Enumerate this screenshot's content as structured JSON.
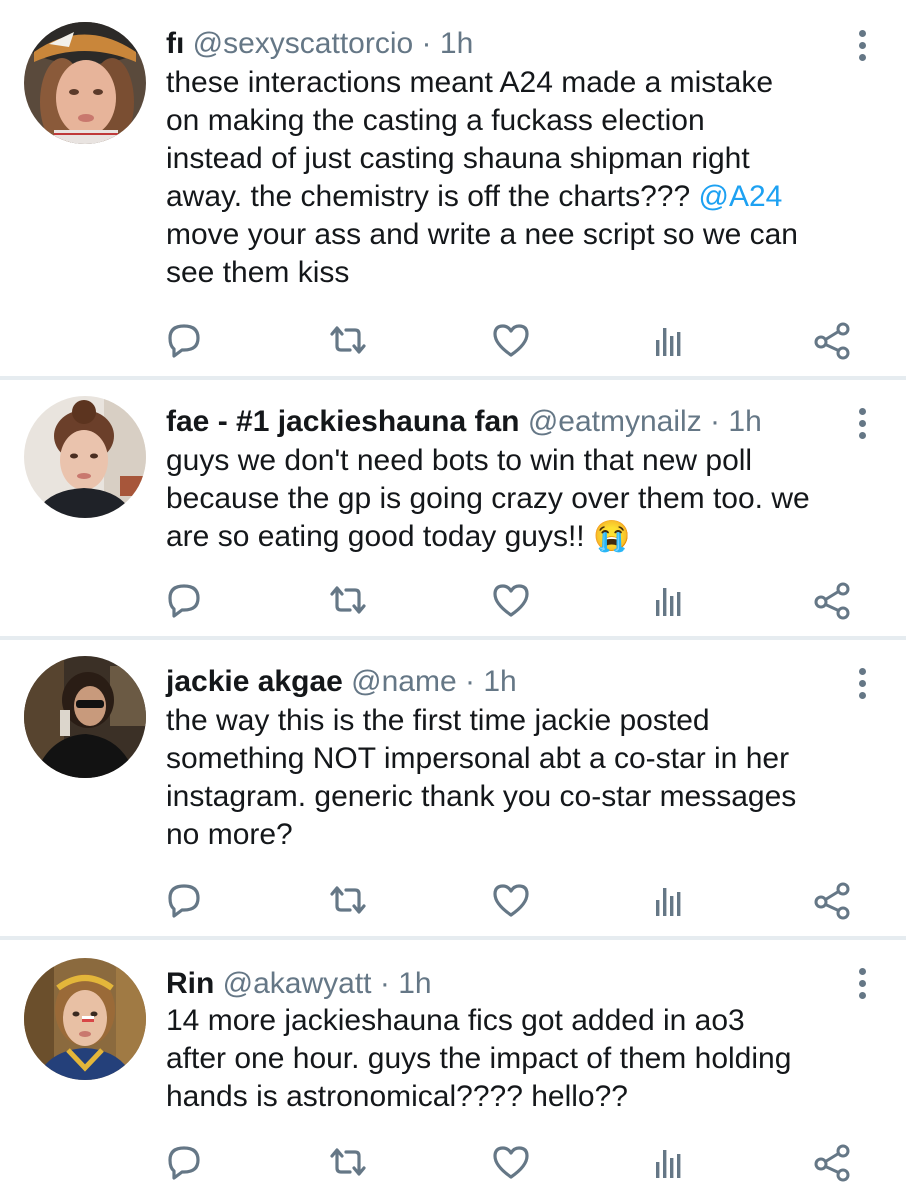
{
  "tweets": [
    {
      "name": "fı",
      "handle": "@sexyscattorcio",
      "sep": "·",
      "time": "1h",
      "text_lines": [
        "these interactions meant A24 made a mistake",
        "on making the casting a fuckass election",
        "instead of just casting shauna shipman right"
      ],
      "line4_pre": "away. the chemistry is off the charts??? ",
      "mention": "@A24",
      "text_lines_after": [
        "move your ass and write a nee script so we can",
        "see them kiss"
      ]
    },
    {
      "name": "fae - #1 jackieshauna fan",
      "handle": "@eatmynailz",
      "sep": "·",
      "time": "1h",
      "text_lines": [
        "guys we don't need bots to win that new poll",
        "because the gp is going crazy over them too. we"
      ],
      "last_line": "are so eating good today guys!! ",
      "emoji": "😭"
    },
    {
      "name": "jackie akgae",
      "handle": "@name",
      "sep": "·",
      "time": "1h",
      "text_lines": [
        "the way this is the first time jackie posted",
        "something NOT impersonal abt a co-star in her",
        "instagram. generic thank you co-star messages",
        "no more?"
      ]
    },
    {
      "name": "Rin",
      "handle": "@akawyatt",
      "sep": "·",
      "time": "1h",
      "text_lines": [
        "14 more jackieshauna fics got added in ao3",
        "after one hour. guys the impact of them holding",
        "hands is astronomical???? hello??"
      ]
    }
  ],
  "icons": {
    "reply": "reply-icon",
    "retweet": "retweet-icon",
    "like": "heart-icon",
    "analytics": "analytics-icon",
    "share": "share-icon",
    "more": "more-vertical-icon"
  },
  "colors": {
    "text": "#14171a",
    "secondary": "#657786",
    "link": "#1da1f2",
    "divider": "#e6ecf0"
  }
}
